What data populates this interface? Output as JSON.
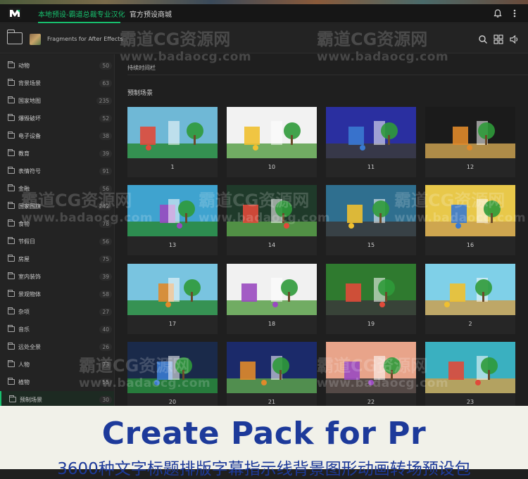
{
  "header": {
    "tabs": [
      {
        "label": "本地预设-霸道总裁专业汉化",
        "active": true
      },
      {
        "label": "官方预设商城",
        "active": false
      }
    ],
    "icons": [
      "bell-icon",
      "more-vertical-icon"
    ]
  },
  "toolbar": {
    "pack_title": "Fragments for After Effects",
    "icons": [
      "search-icon",
      "grid-icon",
      "volume-icon"
    ]
  },
  "sidebar": {
    "items": [
      {
        "label": "动物",
        "count": "50"
      },
      {
        "label": "背景场景",
        "count": "63"
      },
      {
        "label": "国家地图",
        "count": "235"
      },
      {
        "label": "爆毁破坏",
        "count": "52"
      },
      {
        "label": "电子设备",
        "count": "38"
      },
      {
        "label": "教育",
        "count": "39"
      },
      {
        "label": "表情符号",
        "count": "91"
      },
      {
        "label": "金融",
        "count": "56"
      },
      {
        "label": "国家国旗",
        "count": "242"
      },
      {
        "label": "食物",
        "count": "78"
      },
      {
        "label": "节假日",
        "count": "56"
      },
      {
        "label": "房屋",
        "count": "75"
      },
      {
        "label": "室内装饰",
        "count": "39"
      },
      {
        "label": "景观物体",
        "count": "58"
      },
      {
        "label": "杂项",
        "count": "27"
      },
      {
        "label": "音乐",
        "count": "40"
      },
      {
        "label": "远处全景",
        "count": "26"
      },
      {
        "label": "人物",
        "count": "73"
      },
      {
        "label": "植物",
        "count": "55"
      },
      {
        "label": "预制场景",
        "count": "30",
        "active": true
      }
    ]
  },
  "main": {
    "breadcrumb": "持续时间栏",
    "section_title": "预制场景",
    "cards": [
      {
        "label": "1",
        "bg": "#6fb8d6"
      },
      {
        "label": "10",
        "bg": "#f2f2f2"
      },
      {
        "label": "11",
        "bg": "#2a2fa0"
      },
      {
        "label": "12",
        "bg": "#1b1b1b"
      },
      {
        "label": "13",
        "bg": "#3fa3cf"
      },
      {
        "label": "14",
        "bg": "#1f3a2a"
      },
      {
        "label": "15",
        "bg": "#2f6f8f"
      },
      {
        "label": "16",
        "bg": "#e8c84a"
      },
      {
        "label": "17",
        "bg": "#79c4e0"
      },
      {
        "label": "18",
        "bg": "#f1f1f1"
      },
      {
        "label": "19",
        "bg": "#2f7a2f"
      },
      {
        "label": "2",
        "bg": "#7fd0e8"
      },
      {
        "label": "20",
        "bg": "#1a2a4a"
      },
      {
        "label": "21",
        "bg": "#1b2a6a"
      },
      {
        "label": "22",
        "bg": "#e8a48a"
      },
      {
        "label": "23",
        "bg": "#3ab0c0"
      }
    ]
  },
  "watermark": {
    "text": "霸道CG资源网",
    "url": "www.badaocg.com"
  },
  "banner": {
    "title": "Create Pack for Pr",
    "subtitle": "3600种文字标题排版字幕指示线背景图形动画转场预设包"
  },
  "colors": {
    "accent": "#18c06e",
    "banner_text": "#1d3a9a",
    "banner_bg": "#f1f1e9"
  }
}
